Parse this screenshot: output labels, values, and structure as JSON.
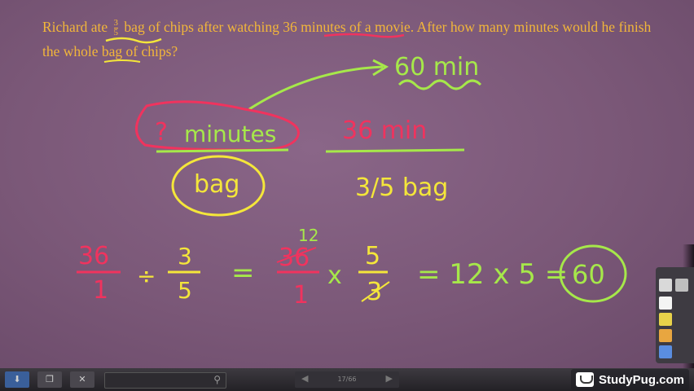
{
  "question": {
    "part1": "Richard ate",
    "frac_num": "3",
    "frac_den": "5",
    "part2": "bag of chips after watching",
    "highlight": "36 minutes",
    "part3": "of a movie. After how many minutes would he finish the whole bag of chips?"
  },
  "board": {
    "answer_note": "60 min",
    "q_mark": "?",
    "minutes_label": "minutes",
    "bag_label": "bag",
    "rate_num": "36 min",
    "rate_den": "3/5 bag",
    "eq_a_num": "36",
    "eq_a_den": "1",
    "eq_div": "÷",
    "eq_b_num": "3",
    "eq_b_den": "5",
    "eq_eq1": "=",
    "eq_c_top": "12",
    "eq_c_num": "36",
    "eq_c_den": "1",
    "eq_times": "x",
    "eq_d_num": "5",
    "eq_d_den": "3",
    "eq_result": "= 12 x 5 =",
    "eq_answer": "60"
  },
  "toolbar": {
    "page_indicator": "17/66",
    "search_placeholder": ""
  },
  "brand": {
    "name": "StudyPug.com"
  },
  "colors": {
    "question_text": "#f2b63a",
    "ink_red": "#f0335e",
    "ink_green": "#a6e84a",
    "ink_yellow": "#f4e63a",
    "board_bg": "#7d5a7a"
  }
}
